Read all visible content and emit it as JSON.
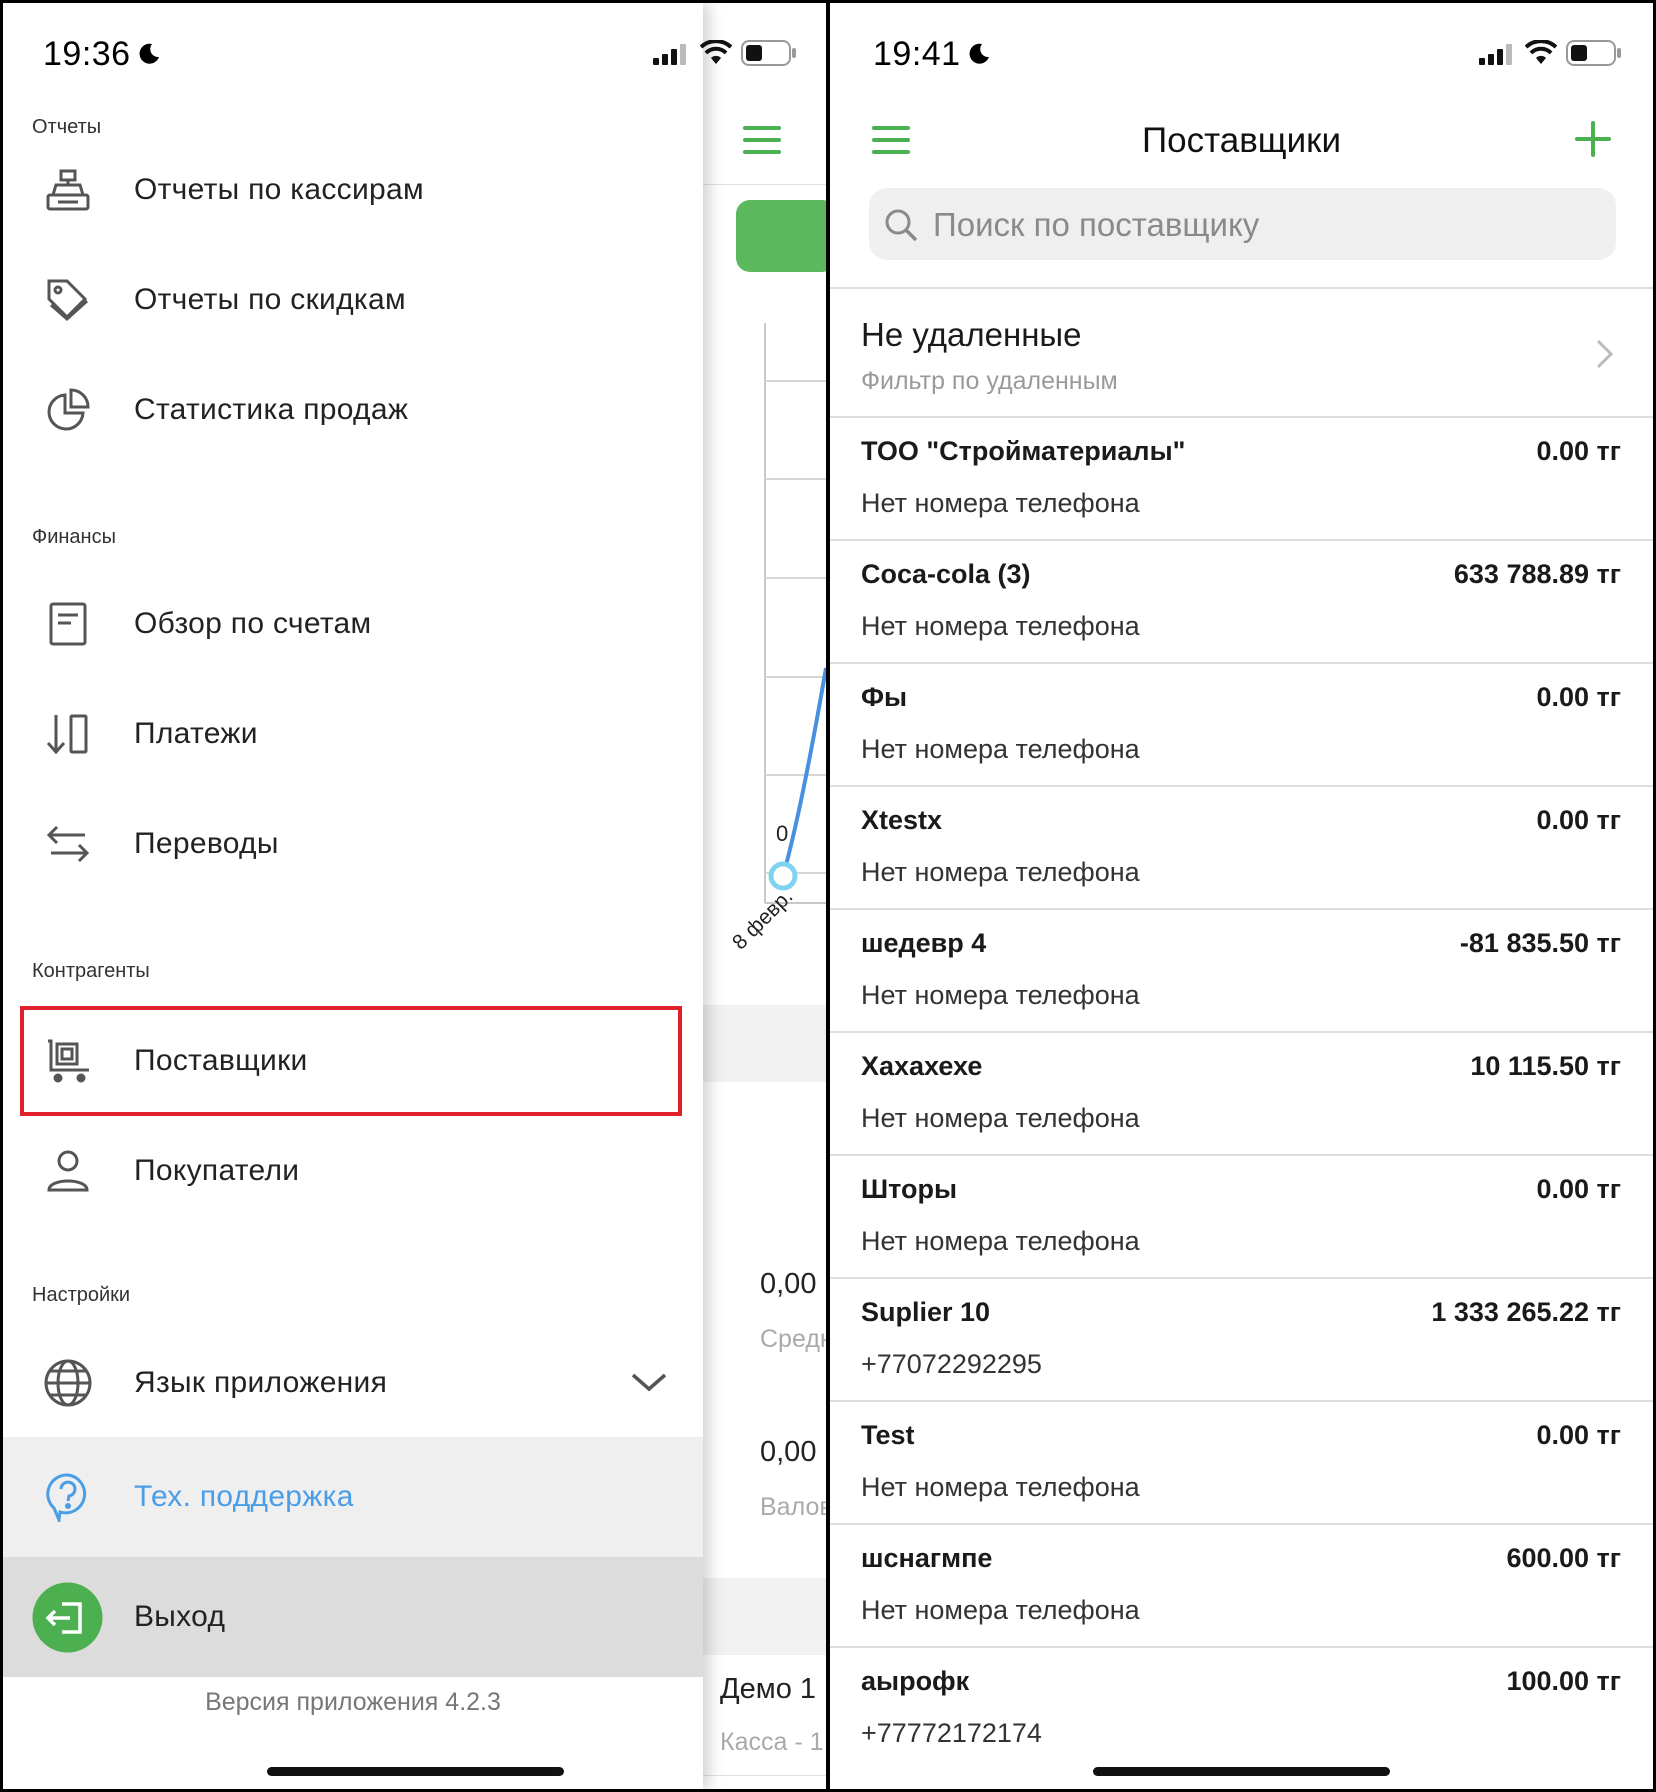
{
  "left_screen": {
    "status": {
      "time": "19:36"
    },
    "sections": {
      "reports": "Отчеты",
      "finance": "Финансы",
      "counterparties": "Контрагенты",
      "settings": "Настройки"
    },
    "menu": {
      "cashier_reports": "Отчеты по кассирам",
      "discount_reports": "Отчеты по скидкам",
      "sales_stats": "Статистика продаж",
      "accounts_overview": "Обзор по счетам",
      "payments": "Платежи",
      "transfers": "Переводы",
      "suppliers": "Поставщики",
      "customers": "Покупатели",
      "app_language": "Язык приложения",
      "support": "Тех. поддержка",
      "logout": "Выход"
    },
    "version": "Версия приложения 4.2.3",
    "behind": {
      "chart_zero": "0",
      "chart_date": "8 февр.",
      "value1": "0,00",
      "label1": "Средн",
      "value2": "0,00",
      "label2": "Валов",
      "item_title": "Демо 1",
      "item_sub": "Касса - 1"
    }
  },
  "right_screen": {
    "status": {
      "time": "19:41"
    },
    "title": "Поставщики",
    "search": {
      "placeholder": "Поиск по поставщику"
    },
    "filter": {
      "title": "Не удаленные",
      "subtitle": "Фильтр по удаленным"
    },
    "suppliers": [
      {
        "name": "ТОО \"Стройматериалы\"",
        "amount": "0.00 тг",
        "phone": "Нет номера телефона"
      },
      {
        "name": "Coca-cola (3)",
        "amount": "633 788.89 тг",
        "phone": "Нет номера телефона"
      },
      {
        "name": "Фы",
        "amount": "0.00 тг",
        "phone": "Нет номера телефона"
      },
      {
        "name": "Xtestx",
        "amount": "0.00 тг",
        "phone": "Нет номера телефона"
      },
      {
        "name": "шедевр 4",
        "amount": "-81 835.50 тг",
        "phone": "Нет номера телефона"
      },
      {
        "name": "Хахахехе",
        "amount": "10 115.50 тг",
        "phone": "Нет номера телефона"
      },
      {
        "name": "Шторы",
        "amount": "0.00 тг",
        "phone": "Нет номера телефона"
      },
      {
        "name": "Suplier 10",
        "amount": "1 333 265.22 тг",
        "phone": "+77072292295"
      },
      {
        "name": "Test",
        "amount": "0.00 тг",
        "phone": "Нет номера телефона"
      },
      {
        "name": "шснагмпе",
        "amount": "600.00 тг",
        "phone": "Нет номера телефона"
      },
      {
        "name": "аырофк",
        "amount": "100.00 тг",
        "phone": "+77772172174"
      }
    ]
  },
  "colors": {
    "accent_green": "#4caf50",
    "support_blue": "#4a9ee8",
    "highlight_red": "#e0202a"
  }
}
